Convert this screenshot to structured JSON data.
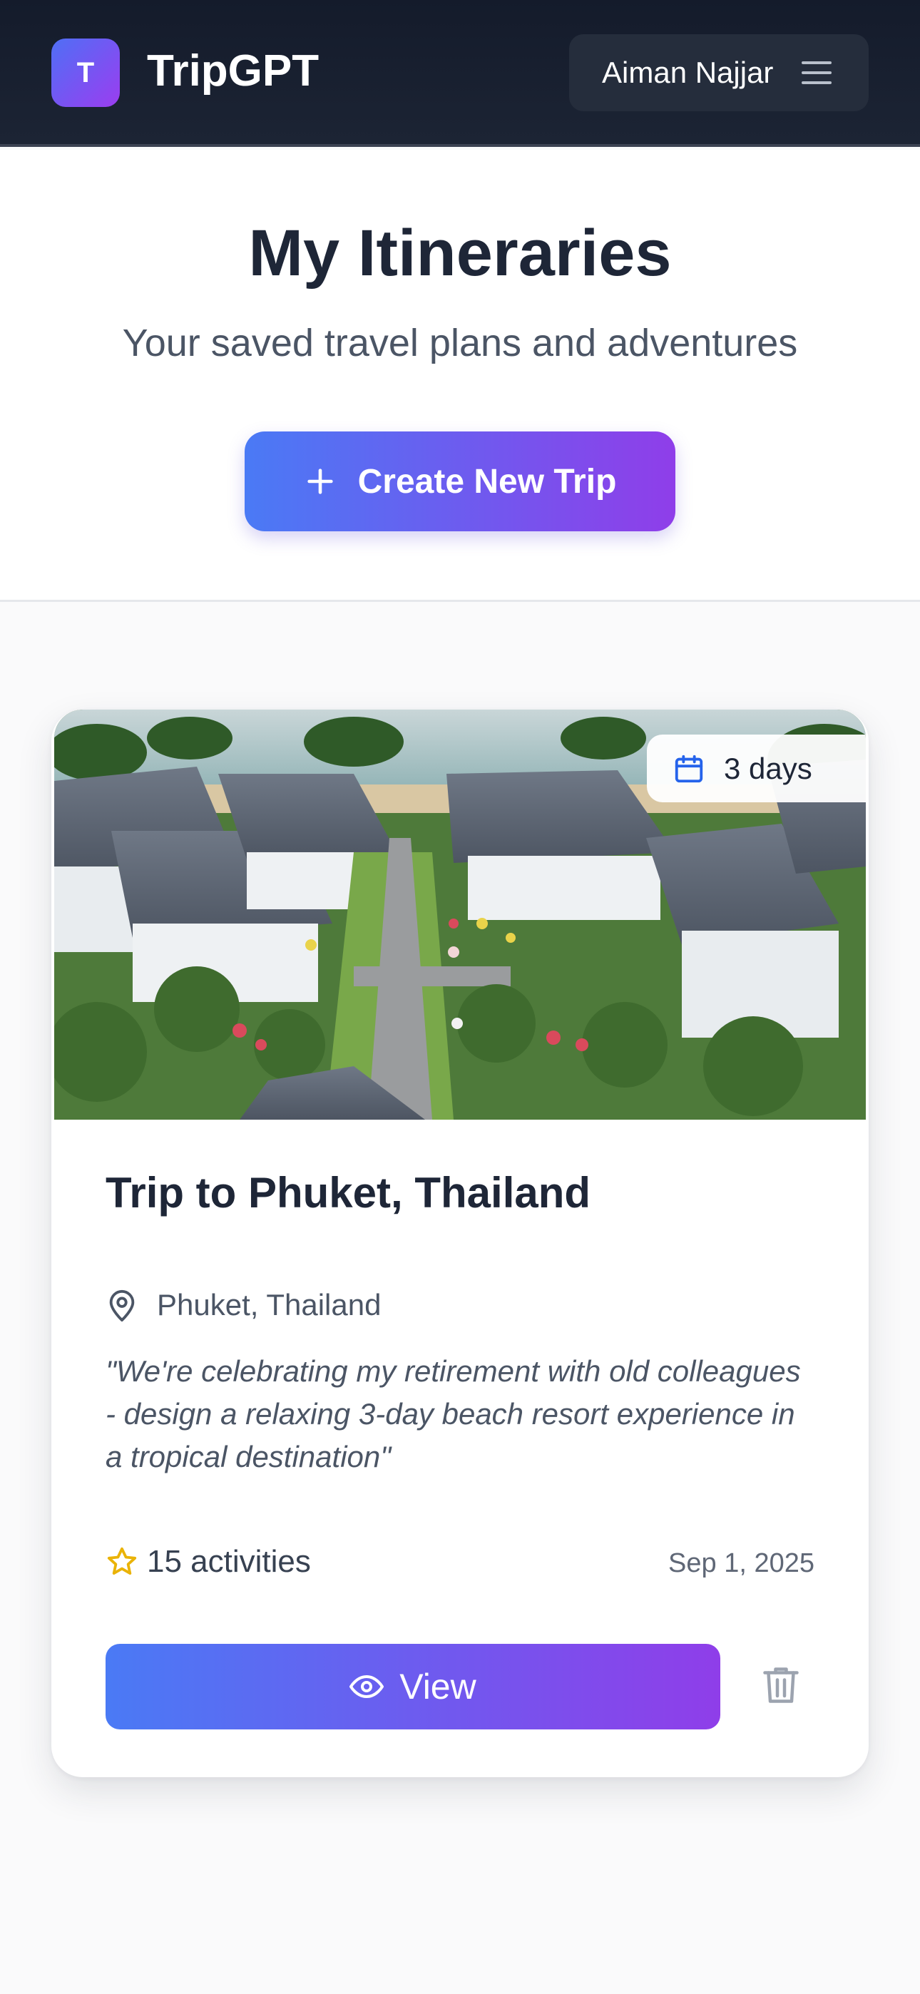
{
  "header": {
    "logo_letter": "T",
    "app_name": "TripGPT",
    "user_name": "Aiman Najjar",
    "menu_icon": "hamburger-menu-icon"
  },
  "hero": {
    "title": "My Itineraries",
    "subtitle": "Your saved travel plans and adventures",
    "create_button_label": "Create New Trip",
    "create_button_icon": "plus-icon"
  },
  "trips": [
    {
      "duration": "3 days",
      "duration_icon": "calendar-icon",
      "image_alt": "Aerial view of a tropical beach resort with villas and gardens",
      "title": "Trip to Phuket, Thailand",
      "location": "Phuket, Thailand",
      "location_icon": "map-pin-icon",
      "prompt": "\"We're celebrating my retirement with old colleagues - design a relaxing 3-day beach resort experience in a tropical destination\"",
      "activities": "15 activities",
      "activities_icon": "star-icon",
      "date": "Sep 1, 2025",
      "view_label": "View",
      "view_icon": "eye-icon",
      "delete_icon": "trash-icon"
    }
  ],
  "colors": {
    "header_bg": "#141b2b",
    "gradient_start": "#4a7af5",
    "gradient_end": "#8f3ee9",
    "title_text": "#1e2637",
    "muted_text": "#4b5565",
    "star": "#eab308",
    "calendar": "#2563eb"
  }
}
